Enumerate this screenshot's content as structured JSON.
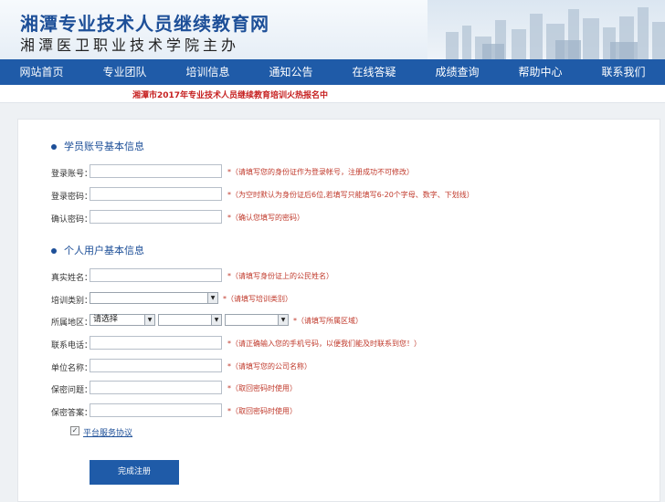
{
  "header": {
    "title": "湘潭专业技术人员继续教育网",
    "subtitle": "湘潭医卫职业技术学院主办"
  },
  "nav": [
    {
      "label": "网站首页"
    },
    {
      "label": "专业团队"
    },
    {
      "label": "培训信息"
    },
    {
      "label": "通知公告"
    },
    {
      "label": "在线答疑"
    },
    {
      "label": "成绩查询"
    },
    {
      "label": "帮助中心"
    },
    {
      "label": "联系我们"
    }
  ],
  "notice": "湘潭市2017年专业技术人员继续教育培训火热报名中",
  "form": {
    "section_account": "学员账号基本信息",
    "section_personal": "个人用户基本信息",
    "login_account_label": "登录账号：",
    "login_account_value": "",
    "login_account_hint": "*（请填写您的身份证作为登录帐号，注册成功不可修改）",
    "password_label": "登录密码：",
    "password_value": "",
    "password_hint": "*（为空时默认为身份证后6位,若填写只能填写6-20个字母、数字、下划线）",
    "confirm_label": "确认密码：",
    "confirm_value": "",
    "confirm_hint": "*（确认您填写的密码）",
    "name_label": "真实姓名：",
    "name_value": "",
    "name_hint": "*（请填写身份证上的公民姓名）",
    "category_label": "培训类别：",
    "category_value": "",
    "category_hint": "*（请填写培训类别）",
    "region_label": "所属地区：",
    "region_select1": "请选择",
    "region_select2": "",
    "region_select3": "",
    "region_hint": "*（请填写所属区域）",
    "phone_label": "联系电话：",
    "phone_value": "",
    "phone_hint": "*（请正确输入您的手机号码，以便我们能及时联系到您！）",
    "company_label": "单位名称：",
    "company_value": "",
    "company_hint": "*（请填写您的公司名称）",
    "question_label": "保密问题：",
    "question_value": "",
    "question_hint": "*（取回密码时使用）",
    "answer_label": "保密答案：",
    "answer_value": "",
    "answer_hint": "*（取回密码时使用）",
    "agree_checked": true,
    "agree_label": "平台服务协议",
    "submit_label": "完成注册"
  },
  "colors": {
    "nav_bg": "#1f5ba8",
    "title_blue": "#1d4f98",
    "hint_red": "#c0392b",
    "notice_red": "#c62020"
  }
}
